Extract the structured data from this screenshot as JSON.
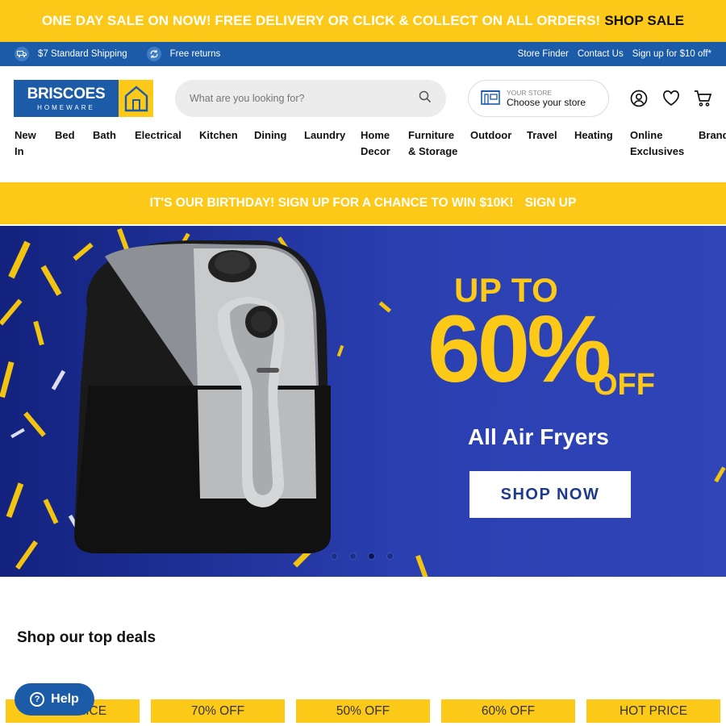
{
  "promo": {
    "text": "ONE DAY SALE ON NOW! FREE DELIVERY OR CLICK & COLLECT ON ALL ORDERS!",
    "cta": "SHOP SALE"
  },
  "util": {
    "shipping": "$7 Standard Shipping",
    "returns": "Free returns",
    "links": [
      "Store Finder",
      "Contact Us",
      "Sign up for $10 off*"
    ]
  },
  "header": {
    "logo_main": "BRISCOES",
    "logo_sub": "HOMEWARE",
    "search_placeholder": "What are you looking for?",
    "store_label": "YOUR STORE",
    "store_value": "Choose your store",
    "icons": [
      "account-icon",
      "wishlist-icon",
      "cart-icon"
    ]
  },
  "nav": [
    "New In",
    "Bed",
    "Bath",
    "Electrical",
    "Kitchen",
    "Dining",
    "Laundry",
    "Home Decor",
    "Furniture & Storage",
    "Outdoor",
    "Travel",
    "Heating",
    "Online Exclusives",
    "Brands"
  ],
  "birthday": {
    "text": "IT'S OUR BIRTHDAY! SIGN UP FOR A CHANCE TO WIN $10K!",
    "cta": "SIGN UP"
  },
  "hero": {
    "upto": "UP TO",
    "percent": "60%",
    "off": "OFF",
    "subtitle": "All Air Fryers",
    "button": "SHOP NOW",
    "slides": 4,
    "active_slide": 3
  },
  "deals": {
    "title": "Shop our top deals",
    "badges": [
      "HOT PRICE",
      "70% OFF",
      "50% OFF",
      "60% OFF",
      "HOT PRICE"
    ]
  },
  "help": {
    "label": "Help"
  },
  "colors": {
    "yellow": "#fcc918",
    "blue": "#1b5ba8",
    "hero": "#2a3fb0"
  }
}
